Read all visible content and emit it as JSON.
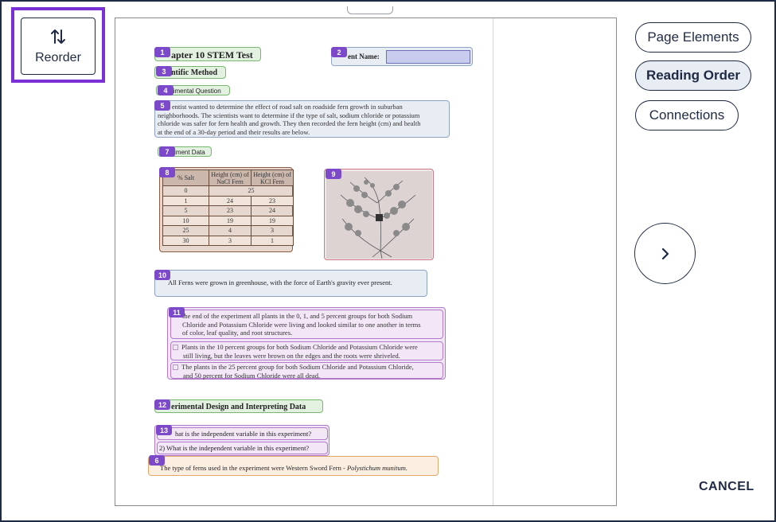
{
  "toolbar": {
    "reorder_label": "Reorder",
    "reorder_icon": "reorder-arrows-icon",
    "accent": "#7b2fd6"
  },
  "view_modes": [
    {
      "label": "Page Elements",
      "active": false
    },
    {
      "label": "Reading Order",
      "active": true
    },
    {
      "label": "Connections",
      "active": false
    }
  ],
  "next_icon": "chevron-right-icon",
  "cancel_label": "CANCEL",
  "document": {
    "regions": [
      {
        "badge": "1",
        "text": "apter 10 STEM Test"
      },
      {
        "badge": "2",
        "text": "ent Name:"
      },
      {
        "badge": "3",
        "text": "ntific Method"
      },
      {
        "badge": "4",
        "text": "rimental Question"
      },
      {
        "badge": "5",
        "lines": [
          "entist wanted to determine the effect of road salt on roadside fern growth in suburban",
          "neighborhoods. The scientists want to determine if the type of salt, sodium chloride or potassium",
          "chloride was safer for fern health and growth. They then recorded the fern height (cm) and health",
          "at the end of a 30-day period and their results are below."
        ]
      },
      {
        "badge": "7",
        "text": "iment Data"
      },
      {
        "badge": "8",
        "table": {
          "headers": [
            "% Salt",
            "Height (cm) of NaCl Fern",
            "Height (cm) of KCl Fern"
          ],
          "rows": [
            [
              "0",
              "25",
              ""
            ],
            [
              "1",
              "24",
              "23"
            ],
            [
              "5",
              "23",
              "24"
            ],
            [
              "10",
              "19",
              "19"
            ],
            [
              "25",
              "4",
              "3"
            ],
            [
              "30",
              "3",
              "1"
            ]
          ]
        }
      },
      {
        "badge": "9",
        "image": "fern-illustration"
      },
      {
        "badge": "10",
        "text": "All Ferns were grown in greenhouse, with the force of Earth's gravity ever present."
      },
      {
        "badge": "11",
        "items": [
          [
            "the end of the experiment all plants in the 0, 1, and 5 percent groups for both Sodium",
            "Chloride and Potassium Chloride were living and looked similar to one another in terms",
            "of color, leaf quality, and root structures."
          ],
          [
            "Plants in the 10 percent groups for both Sodium Chloride and Potassium Chloride were",
            "still living, but the leaves were brown on the edges and the roots were shriveled."
          ],
          [
            "The plants in the 25 percent group for both Sodium Chloride and Potassium Chloride,",
            "and 50 percent for Sodium Chloride were all dead."
          ]
        ]
      },
      {
        "badge": "12",
        "text": "erimental Design and Interpreting Data"
      },
      {
        "badge": "13",
        "items": [
          "hat is the independent variable in this experiment?",
          "2)  What is the independent variable in this experiment?"
        ]
      },
      {
        "badge": "6",
        "text": "The type of ferns used in the experiment were Western Sword Fern - ",
        "italic": "Polystichum munitum."
      }
    ]
  },
  "colors": {
    "badge": "#7b49c9",
    "heading_box": "#e2f1e0",
    "text_box": "#e8ecf3",
    "list_box": "#f2e6f7",
    "figure_box": "#f3e6e8",
    "caption_box": "#fcefe2",
    "table_box": "#e6d8cf",
    "navy": "#1f2a44"
  }
}
